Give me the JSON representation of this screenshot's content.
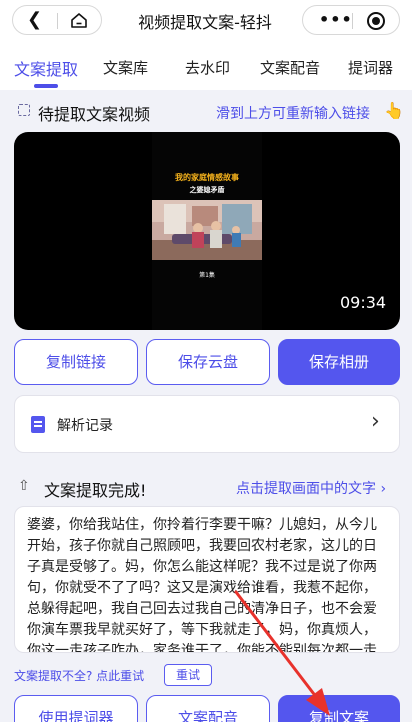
{
  "header": {
    "back_glyph": "❮",
    "title": "视频提取文案-轻抖",
    "more_glyph": "•••"
  },
  "tabs": [
    {
      "label": "文案提取",
      "active": true
    },
    {
      "label": "文案库"
    },
    {
      "label": "去水印"
    },
    {
      "label": "文案配音"
    },
    {
      "label": "提词器"
    }
  ],
  "video_section": {
    "title": "待提取文案视频",
    "hint_link": "滑到上方可重新输入链接",
    "hint_icon": "pointing-hand-icon",
    "video": {
      "overlay_title": "我的家庭情感故事",
      "overlay_subtitle": "之婆媳矛盾",
      "episode": "第1集",
      "duration": "09:34"
    }
  },
  "actions": {
    "copy_link": "复制链接",
    "save_cloud": "保存云盘",
    "save_album": "保存相册"
  },
  "record": {
    "label": "解析记录",
    "chevron": "›"
  },
  "result_section": {
    "icon": "share-icon",
    "title": "文案提取完成!",
    "link": "点击提取画面中的文字 ›",
    "text": "婆婆，你给我站住，你拎着行李要干嘛？儿媳妇，从今儿开始，孩子你就自己照顾吧，我要回农村老家，这儿的日子真是受够了。妈，你怎么能这样呢？我不过是说了你两句，你就受不了了吗？这又是演戏给谁看，我惹不起你，总躲得起吧，我自己回去过我自己的清净日子，也不会爱你演车票我早就买好了，等下我就走了，妈，你真烦人，你这一走孩子咋办，家务谁干了，你能不能别每次都一走来吓唬我，你以为我还会再玩笑吗？",
    "retry_text": "文案提取不全? 点此重试",
    "retry_button": "重试"
  },
  "bottom_actions": {
    "teleprompter": "使用提词器",
    "dubbing": "文案配音",
    "copy_text": "复制文案"
  },
  "colors": {
    "accent": "#4d4ee8",
    "primary_button": "#5456ee",
    "annotation_arrow": "#e8322c",
    "background": "#f1f2f8"
  }
}
